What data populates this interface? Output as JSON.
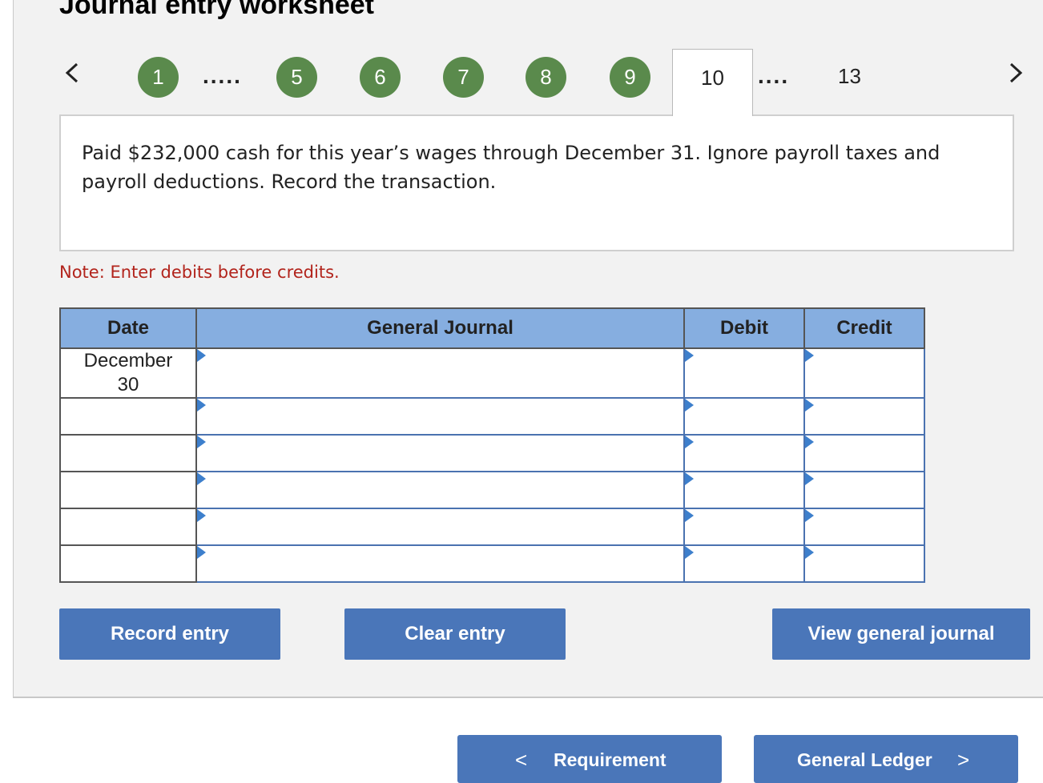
{
  "header": {
    "title": "Journal entry worksheet"
  },
  "pager": {
    "items": [
      "1",
      "5",
      "6",
      "7",
      "8",
      "9"
    ],
    "active": "10",
    "last": "13",
    "ellipsis_a": ".....",
    "ellipsis_b": "....",
    "prev_icon": "chevron-left-icon",
    "next_icon": "chevron-right-icon",
    "completed_color": "#5a8a4c"
  },
  "question": {
    "text": "Paid $232,000 cash for this year’s wages through December 31. Ignore payroll taxes and payroll deductions. Record the transaction."
  },
  "note": "Note: Enter debits before credits.",
  "journal": {
    "headers": {
      "date": "Date",
      "account": "General Journal",
      "debit": "Debit",
      "credit": "Credit"
    },
    "rows": [
      {
        "date": "December\n30",
        "account": "",
        "debit": "",
        "credit": ""
      },
      {
        "date": "",
        "account": "",
        "debit": "",
        "credit": ""
      },
      {
        "date": "",
        "account": "",
        "debit": "",
        "credit": ""
      },
      {
        "date": "",
        "account": "",
        "debit": "",
        "credit": ""
      },
      {
        "date": "",
        "account": "",
        "debit": "",
        "credit": ""
      },
      {
        "date": "",
        "account": "",
        "debit": "",
        "credit": ""
      }
    ],
    "header_color": "#86aee0"
  },
  "actions": {
    "record": "Record entry",
    "clear": "Clear entry",
    "view": "View general journal",
    "button_color": "#4a76b9"
  },
  "footer_nav": {
    "prev_label": "Requirement",
    "next_label": "General Ledger"
  }
}
